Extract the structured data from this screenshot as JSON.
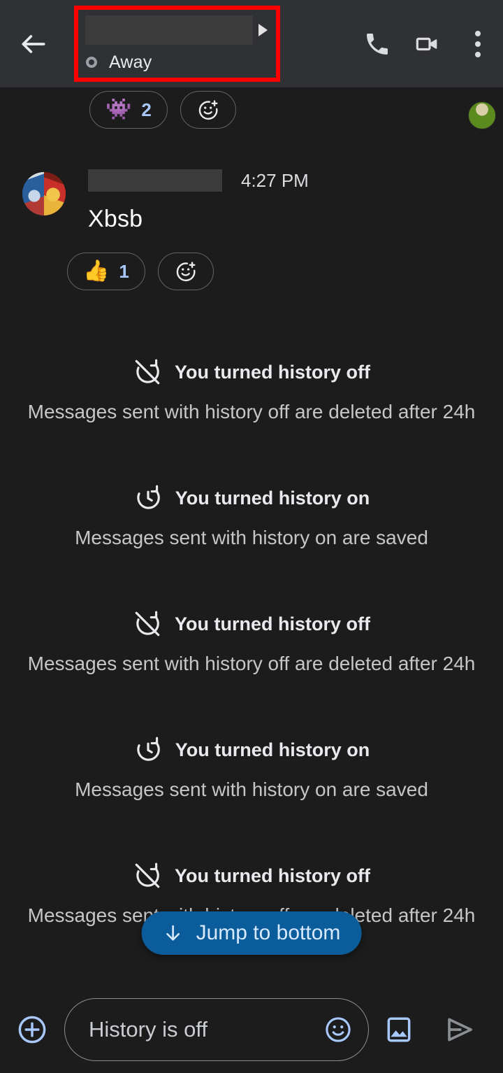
{
  "appbar": {
    "back_icon": "back-arrow-icon",
    "title_redacted": "",
    "expand_icon": "caret-right-icon",
    "status_label": "Away",
    "status_icon": "away-status-ring-icon",
    "call_icon": "phone-icon",
    "video_icon": "video-camera-icon",
    "overflow_icon": "three-dot-overflow-icon",
    "annotation_color": "#ff0000"
  },
  "chat": {
    "top_reactions": [
      {
        "emoji": "👾",
        "count": "2",
        "name": "alien-monster-reaction"
      }
    ],
    "add_reaction_label": "add-reaction",
    "read_receipt": "read-receipt-avatar",
    "message": {
      "sender_redacted": "",
      "time": "4:27 PM",
      "text": "Xbsb",
      "avatar": "contact-avatar",
      "reactions": [
        {
          "emoji": "👍",
          "count": "1",
          "name": "thumbs-up-reaction"
        }
      ]
    },
    "events": [
      {
        "state": "off",
        "icon": "history-off-icon",
        "title": "You turned history off",
        "subtitle": "Messages sent with history off are deleted after 24h"
      },
      {
        "state": "on",
        "icon": "history-on-icon",
        "title": "You turned history on",
        "subtitle": "Messages sent with history on are saved"
      },
      {
        "state": "off",
        "icon": "history-off-icon",
        "title": "You turned history off",
        "subtitle": "Messages sent with history off are deleted after 24h"
      },
      {
        "state": "on",
        "icon": "history-on-icon",
        "title": "You turned history on",
        "subtitle": "Messages sent with history on are saved"
      },
      {
        "state": "off",
        "icon": "history-off-icon",
        "title": "You turned history off",
        "subtitle": "Messages sent with history off are deleted after 24h"
      }
    ],
    "jump_to_bottom": {
      "label": "Jump to bottom",
      "icon": "arrow-down-icon",
      "background": "#0b5c9a",
      "text_color": "#d7e9ff"
    }
  },
  "composer": {
    "add_icon": "plus-circle-icon",
    "placeholder": "History is off",
    "value": "",
    "emoji_icon": "emoji-smiley-icon",
    "gallery_icon": "image-icon",
    "send_icon": "send-icon",
    "accent_color": "#a8c7fa"
  }
}
